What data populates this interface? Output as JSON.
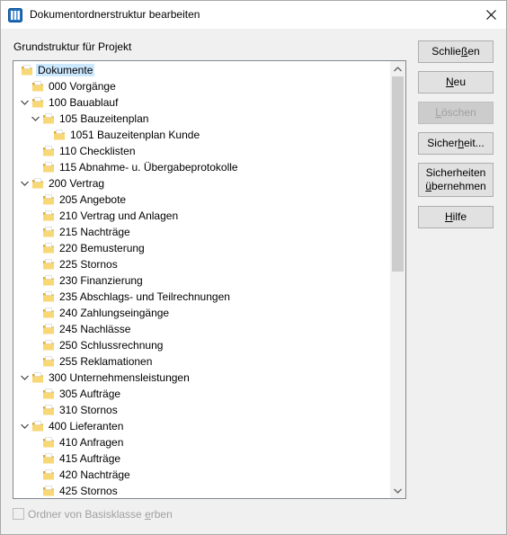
{
  "window": {
    "title": "Dokumentordnerstruktur bearbeiten"
  },
  "group_label": "Grundstruktur für Projekt",
  "tree": [
    {
      "label": "Dokumente",
      "level": 0,
      "expander": "none",
      "selected": true
    },
    {
      "label": "000 Vorgänge",
      "level": 1,
      "expander": "none"
    },
    {
      "label": "100 Bauablauf",
      "level": 1,
      "expander": "expanded"
    },
    {
      "label": "105 Bauzeitenplan",
      "level": 2,
      "expander": "expanded"
    },
    {
      "label": "1051 Bauzeitenplan Kunde",
      "level": 3,
      "expander": "none"
    },
    {
      "label": "110 Checklisten",
      "level": 2,
      "expander": "none"
    },
    {
      "label": "115 Abnahme- u. Übergabeprotokolle",
      "level": 2,
      "expander": "none"
    },
    {
      "label": "200 Vertrag",
      "level": 1,
      "expander": "expanded"
    },
    {
      "label": "205 Angebote",
      "level": 2,
      "expander": "none"
    },
    {
      "label": "210 Vertrag und Anlagen",
      "level": 2,
      "expander": "none"
    },
    {
      "label": "215 Nachträge",
      "level": 2,
      "expander": "none"
    },
    {
      "label": "220 Bemusterung",
      "level": 2,
      "expander": "none"
    },
    {
      "label": "225 Stornos",
      "level": 2,
      "expander": "none"
    },
    {
      "label": "230 Finanzierung",
      "level": 2,
      "expander": "none"
    },
    {
      "label": "235 Abschlags- und Teilrechnungen",
      "level": 2,
      "expander": "none"
    },
    {
      "label": "240 Zahlungseingänge",
      "level": 2,
      "expander": "none"
    },
    {
      "label": "245 Nachlässe",
      "level": 2,
      "expander": "none"
    },
    {
      "label": "250 Schlussrechnung",
      "level": 2,
      "expander": "none"
    },
    {
      "label": "255 Reklamationen",
      "level": 2,
      "expander": "none"
    },
    {
      "label": "300 Unternehmensleistungen",
      "level": 1,
      "expander": "expanded"
    },
    {
      "label": "305 Aufträge",
      "level": 2,
      "expander": "none"
    },
    {
      "label": "310 Stornos",
      "level": 2,
      "expander": "none"
    },
    {
      "label": "400 Lieferanten",
      "level": 1,
      "expander": "expanded"
    },
    {
      "label": "410 Anfragen",
      "level": 2,
      "expander": "none"
    },
    {
      "label": "415 Aufträge",
      "level": 2,
      "expander": "none"
    },
    {
      "label": "420 Nachträge",
      "level": 2,
      "expander": "none"
    },
    {
      "label": "425 Stornos",
      "level": 2,
      "expander": "none"
    }
  ],
  "buttons": {
    "close": {
      "pre": "Schlie",
      "key": "ß",
      "post": "en"
    },
    "new": {
      "pre": "",
      "key": "N",
      "post": "eu"
    },
    "delete": {
      "pre": "",
      "key": "L",
      "post": "öschen"
    },
    "security": {
      "pre": "Sicher",
      "key": "h",
      "post": "eit..."
    },
    "adopt_line1": "Sicherheiten",
    "adopt_line2_pre": "",
    "adopt_line2_key": "ü",
    "adopt_line2_post": "bernehmen",
    "help": {
      "pre": "",
      "key": "H",
      "post": "ilfe"
    }
  },
  "checkbox": {
    "label_pre": "Ordner von Basisklasse ",
    "label_key": "e",
    "label_post": "rben",
    "checked": false
  },
  "colors": {
    "selection": "#cce8ff",
    "folder_fill": "#f8d775",
    "folder_dark": "#dcaa2e",
    "window_bg": "#f0f0f0"
  }
}
